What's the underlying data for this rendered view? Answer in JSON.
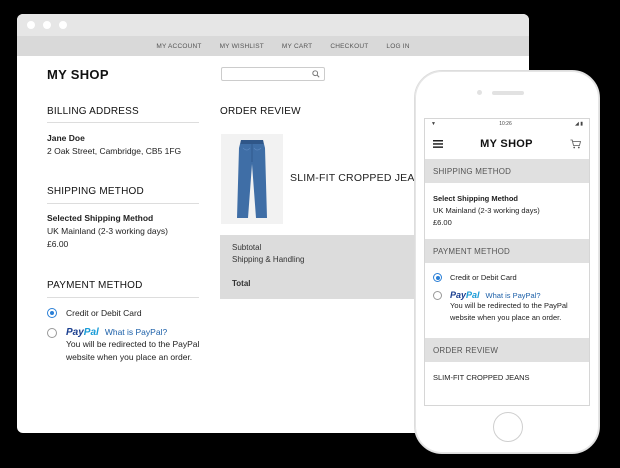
{
  "desktop": {
    "nav": [
      "MY ACCOUNT",
      "MY WISHLIST",
      "MY CART",
      "CHECKOUT",
      "LOG IN"
    ],
    "shop_name": "MY SHOP",
    "search": {
      "placeholder": ""
    },
    "billing": {
      "title": "BILLING ADDRESS",
      "name": "Jane Doe",
      "address": "2 Oak Street, Cambridge, CB5 1FG"
    },
    "shipping": {
      "title": "SHIPPING METHOD",
      "heading": "Selected Shipping Method",
      "option": "UK Mainland (2-3 working days)",
      "price": "£6.00"
    },
    "payment": {
      "title": "PAYMENT METHOD",
      "card_label": "Credit or Debit Card",
      "paypal_logo_a": "Pay",
      "paypal_logo_b": "Pal",
      "paypal_link": "What is PayPal?",
      "paypal_note": "You will be redirected to the PayPal website when you place an order."
    },
    "order_review": {
      "title": "ORDER REVIEW",
      "product_name": "SLIM-FIT CROPPED JEANS",
      "subtotal_label": "Subtotal",
      "shipping_label": "Shipping & Handling",
      "total_label": "Total"
    }
  },
  "mobile": {
    "status_time": "10:26",
    "shop_name": "MY SHOP",
    "shipping": {
      "band": "SHIPPING METHOD",
      "heading": "Select Shipping Method",
      "option": "UK Mainland (2-3 working days)",
      "price": "£6.00"
    },
    "payment": {
      "band": "PAYMENT METHOD",
      "card_label": "Credit or Debit Card",
      "paypal_logo_a": "Pay",
      "paypal_logo_b": "Pal",
      "paypal_link": "What is PayPal?",
      "paypal_note": "You will be redirected to the PayPal website when you place an order."
    },
    "order_review": {
      "band": "ORDER REVIEW",
      "product_name": "SLIM-FIT CROPPED JEANS"
    }
  },
  "colors": {
    "background": "#000000",
    "accent": "#2a7fd6",
    "paypal_dark": "#1a3e8f",
    "paypal_light": "#179bd7",
    "band": "#e0e0e0"
  },
  "icons": [
    "search-icon",
    "hamburger-menu-icon",
    "cart-icon"
  ]
}
